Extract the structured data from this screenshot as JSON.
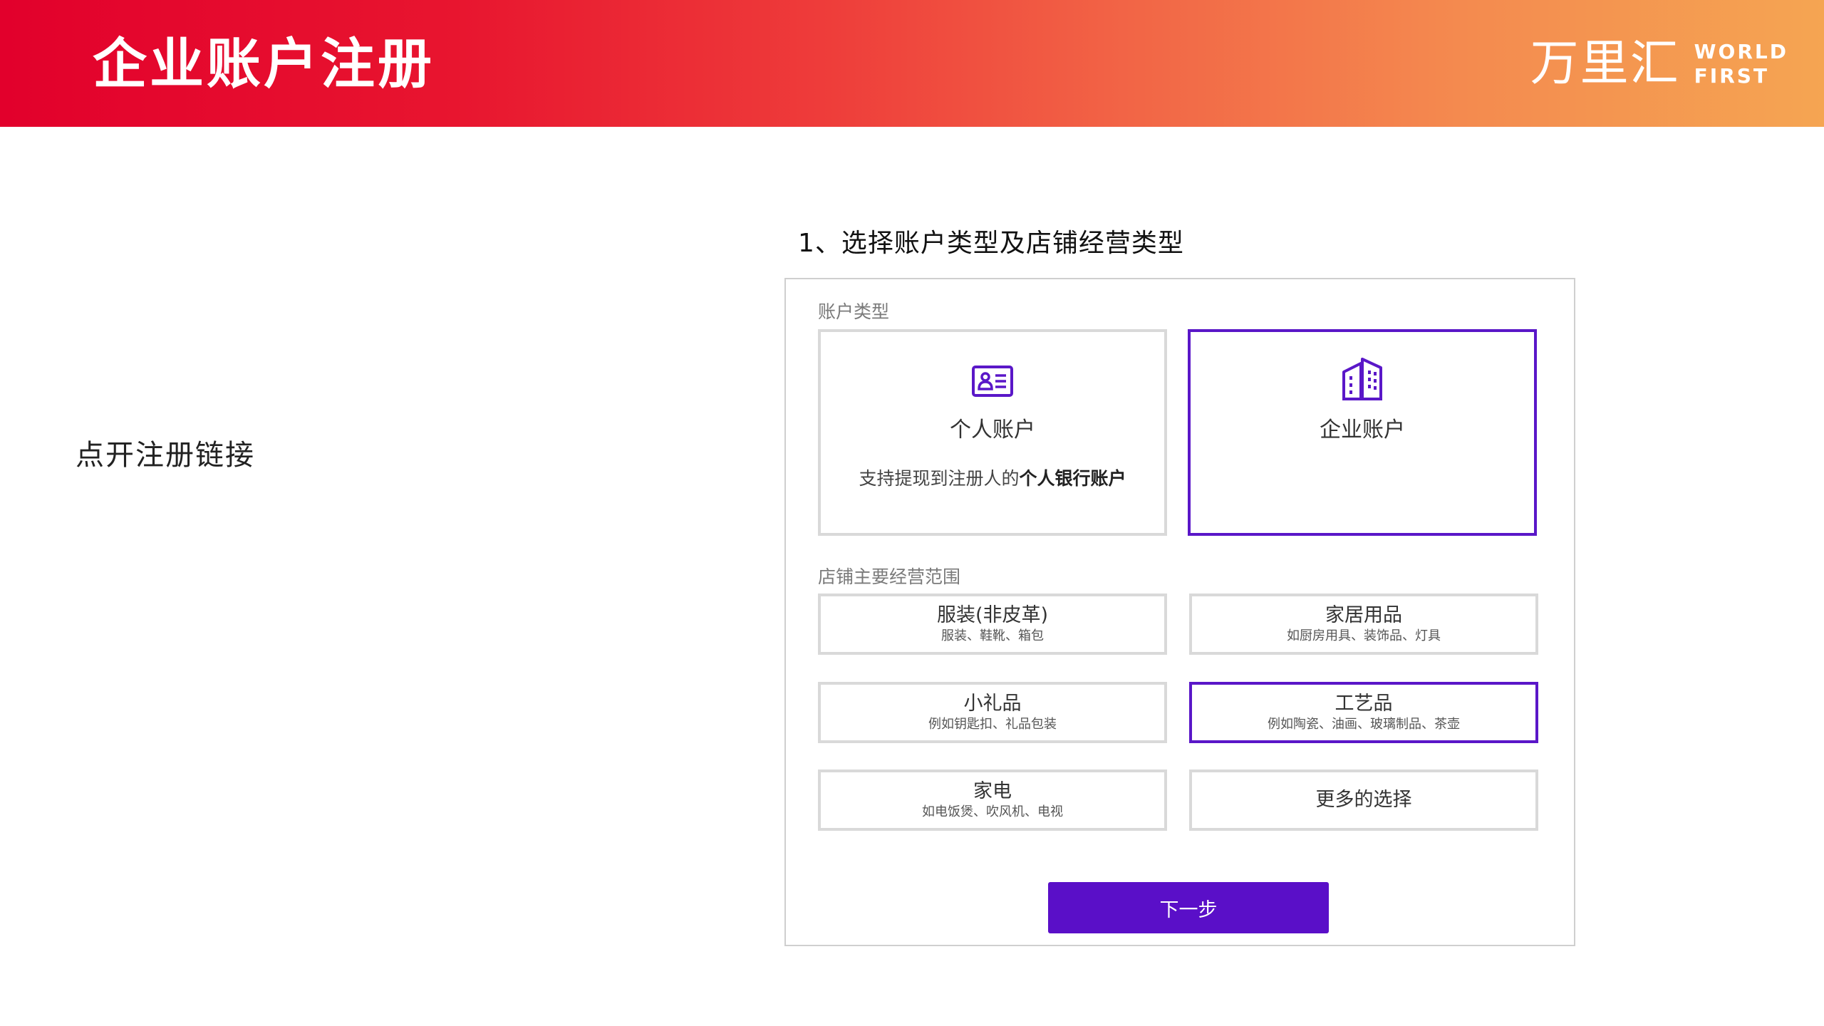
{
  "header": {
    "title": "企业账户注册",
    "brand_cn": "万里汇",
    "brand_en_line1": "WORLD",
    "brand_en_line2": "FIRST"
  },
  "left_note": "点开注册链接",
  "step_title": "1、选择账户类型及店铺经营类型",
  "form": {
    "account_type_label": "账户类型",
    "personal": {
      "name": "个人账户",
      "desc_prefix": "支持提现到注册人的",
      "desc_bold": "个人银行账户",
      "icon": "id-card-icon"
    },
    "business": {
      "name": "企业账户",
      "icon": "building-icon",
      "selected": true
    },
    "category_label": "店铺主要经营范围",
    "categories": [
      {
        "name": "服装(非皮革)",
        "sub": "服装、鞋靴、箱包"
      },
      {
        "name": "家居用品",
        "sub": "如厨房用具、装饰品、灯具"
      },
      {
        "name": "小礼品",
        "sub": "例如钥匙扣、礼品包装"
      },
      {
        "name": "工艺品",
        "sub": "例如陶瓷、油画、玻璃制品、茶壶",
        "selected": true
      },
      {
        "name": "家电",
        "sub": "如电饭煲、吹风机、电视"
      },
      {
        "name": "更多的选择"
      }
    ],
    "next_button": "下一步"
  },
  "colors": {
    "accent": "#5a17c8",
    "button": "#5a0fc8",
    "header_start": "#e2002c",
    "header_end": "#f5a552"
  }
}
